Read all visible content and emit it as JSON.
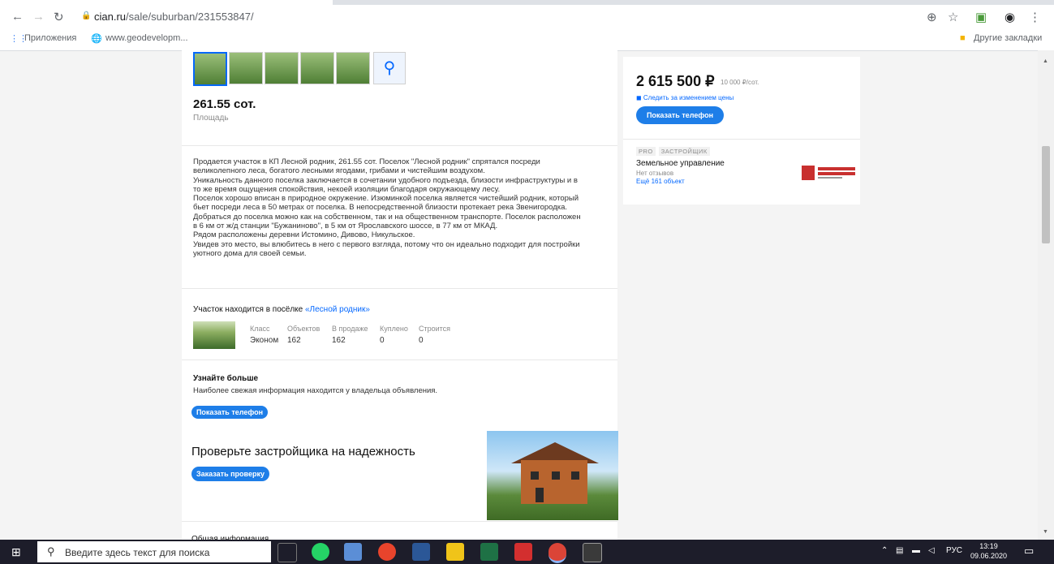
{
  "browser": {
    "url_host": "cian.ru",
    "url_path": "/sale/suburban/231553847/",
    "bookmarks": [
      "Приложения",
      "www.geodevelopm..."
    ],
    "other_bookmarks": "Другие закладки"
  },
  "listing": {
    "area_value": "261.55 сот.",
    "area_label": "Площадь",
    "description": "Продается участок в КП Лесной родник, 261.55 сот. Поселок \"Лесной родник\" спрятался посреди\nвеликолепного леса, богатого лесными ягодами, грибами и чистейшим воздухом.\nУникальность данного поселка заключается в сочетании удобного подъезда, близости инфраструктуры и в\nто же время ощущения спокойствия, некоей изоляции благодаря окружающему лесу.\nПоселок хорошо вписан в природное окружение. Изюминкой поселка является чистейший родник, который\nбьет посреди леса в 50 метрах от поселка. В непосредственной близости протекает река Звенигородка.\nДобраться до поселка можно как на собственном, так и на общественном транспорте. Поселок расположен\nв 6 км от ж/д станции \"Бужаниново\", в 5 км от Ярославского шоссе, в 77 км от МКАД.\nРядом расположены деревни Истомино, Дивово, Никульское.\nУвидев это место, вы влюбитесь в него с первого взгляда, потому что он идеально подходит для постройки\nуютного дома для своей семьи."
  },
  "village": {
    "title_prefix": "Участок находится в посёлке",
    "name": "«Лесной родник»",
    "stats": [
      {
        "header": "Класс",
        "value": "Эконом"
      },
      {
        "header": "Объектов",
        "value": "162"
      },
      {
        "header": "В продаже",
        "value": "162"
      },
      {
        "header": "Куплено",
        "value": "0"
      },
      {
        "header": "Строится",
        "value": "0"
      }
    ]
  },
  "learn_more": {
    "title": "Узнайте больше",
    "text": "Наиболее свежая информация находится у владельца объявления.",
    "button": "Показать телефон"
  },
  "check_builder": {
    "title": "Проверьте застройщика на надежность",
    "button": "Заказать проверку"
  },
  "common_info": "Общая информация",
  "sidebar": {
    "price": "2 615 500 ₽",
    "price_per": "10 000 ₽/сот.",
    "follow_price": "Следить за изменением цены",
    "phone_button": "Показать телефон",
    "tags": [
      "PRO",
      "ЗАСТРОЙЩИК"
    ],
    "developer": "Земельное управление",
    "reviews": "Нет отзывов",
    "more_objects": "Ещё 161 объект"
  },
  "taskbar": {
    "search_placeholder": "Введите здесь текст для поиска",
    "lang": "РУС",
    "time": "13:19",
    "date": "09.06.2020"
  },
  "colors": {
    "accent": "#1e7ee8",
    "link": "#0468ff"
  }
}
